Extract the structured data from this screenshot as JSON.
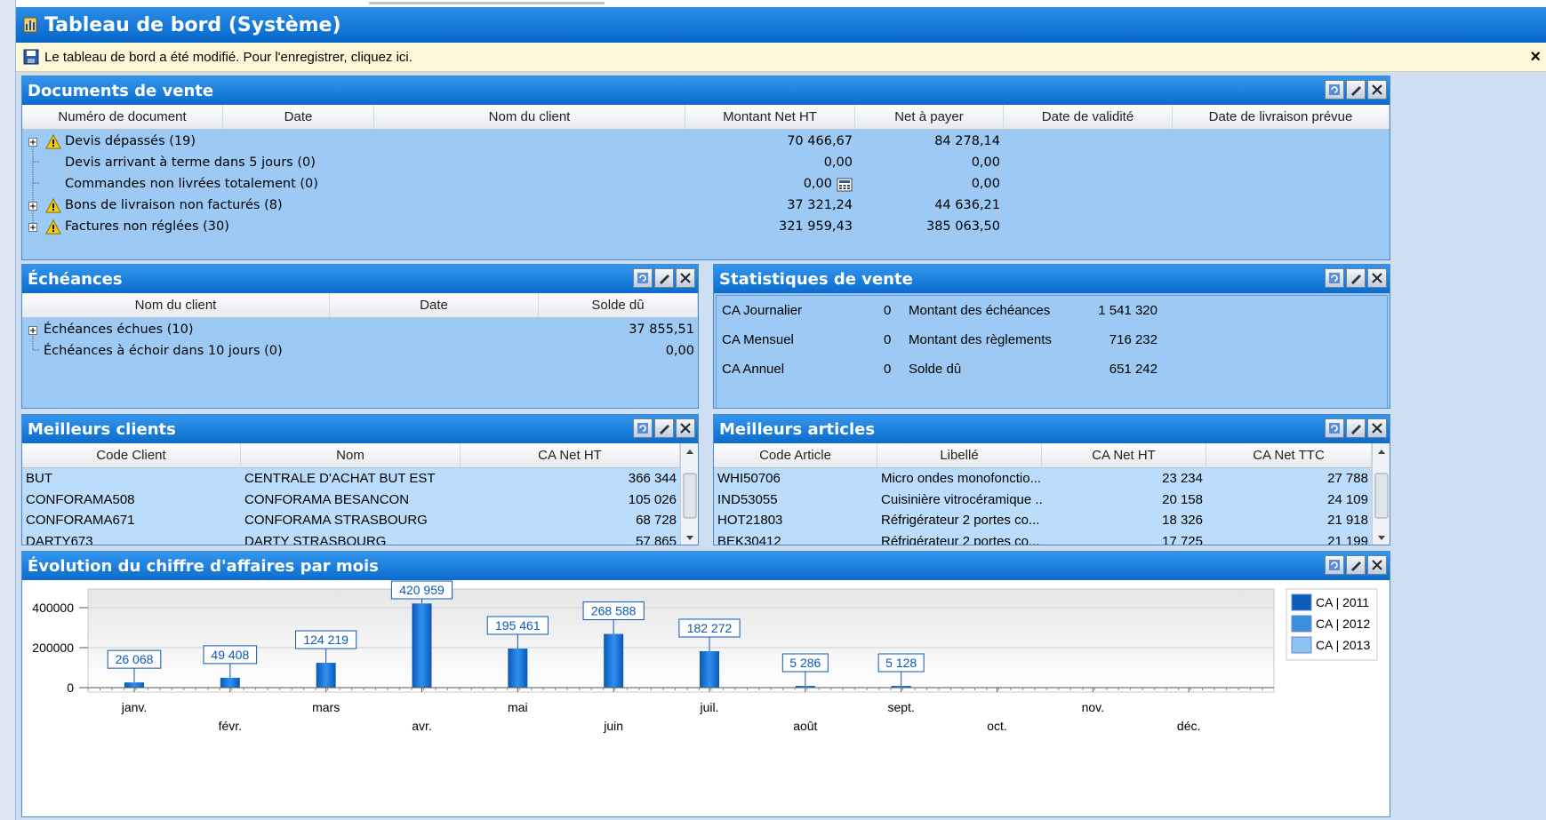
{
  "window": {
    "title": "Tableau de bord (Système)",
    "notice": "Le tableau de bord a été modifié. Pour l'enregistrer, cliquez ici.",
    "close": "×"
  },
  "docs": {
    "title": "Documents de vente",
    "headers": [
      "Numéro de document",
      "Date",
      "Nom du client",
      "Montant Net HT",
      "Net à payer",
      "Date de validité",
      "Date de livraison prévue"
    ],
    "rows": [
      {
        "label": "Devis dépassés (19)",
        "montant": "70 466,67",
        "net": "84 278,14"
      },
      {
        "label": "Devis arrivant à terme dans 5 jours (0)",
        "montant": "0,00",
        "net": "0,00"
      },
      {
        "label": "Commandes non livrées totalement (0)",
        "montant": "0,00",
        "net": "0,00"
      },
      {
        "label": "Bons de livraison non facturés (8)",
        "montant": "37 321,24",
        "net": "44 636,21"
      },
      {
        "label": "Factures non réglées (30)",
        "montant": "321 959,43",
        "net": "385 063,50"
      }
    ]
  },
  "echeances": {
    "title": "Échéances",
    "headers": [
      "Nom du client",
      "Date",
      "Solde dû"
    ],
    "rows": [
      {
        "label": "Échéances échues (10)",
        "solde": "37 855,51"
      },
      {
        "label": "Échéances à échoir dans 10 jours (0)",
        "solde": "0,00"
      }
    ]
  },
  "stats": {
    "title": "Statistiques de vente",
    "rows": [
      {
        "l1": "CA Journalier",
        "v1": "0",
        "l2": "Montant des échéances",
        "v2": "1 541 320"
      },
      {
        "l1": "CA Mensuel",
        "v1": "0",
        "l2": "Montant des règlements",
        "v2": "716 232"
      },
      {
        "l1": "CA Annuel",
        "v1": "0",
        "l2": "Solde dû",
        "v2": "651 242"
      }
    ]
  },
  "clients": {
    "title": "Meilleurs clients",
    "headers": [
      "Code Client",
      "Nom",
      "CA Net HT"
    ],
    "rows": [
      [
        "BUT",
        "CENTRALE D'ACHAT BUT EST",
        "366 344"
      ],
      [
        "CONFORAMA508",
        "CONFORAMA BESANCON",
        "105 026"
      ],
      [
        "CONFORAMA671",
        "CONFORAMA STRASBOURG",
        "68 728"
      ],
      [
        "DARTY673",
        "DARTY STRASBOURG",
        "57 865"
      ]
    ]
  },
  "articles": {
    "title": "Meilleurs articles",
    "headers": [
      "Code Article",
      "Libellé",
      "CA Net HT",
      "CA Net TTC"
    ],
    "rows": [
      [
        "WHI50706",
        "Micro ondes monofonctio...",
        "23 234",
        "27 788"
      ],
      [
        "IND53055",
        "Cuisinière vitrocéramique ...",
        "20 158",
        "24 109"
      ],
      [
        "HOT21803",
        "Réfrigérateur 2 portes co...",
        "18 326",
        "21 918"
      ],
      [
        "BEK30412",
        "Réfrigérateur 2 portes co...",
        "17 725",
        "21 199"
      ]
    ]
  },
  "evolution": {
    "title": "Évolution du chiffre d'affaires par mois"
  },
  "colors": {
    "accent": "#0b6ccd",
    "panel": "#9ccaf5",
    "bar2011": "#0f6fd0"
  },
  "chart_data": {
    "type": "bar",
    "categories": [
      "janv.",
      "févr.",
      "mars",
      "avr.",
      "mai",
      "juin",
      "juil.",
      "août",
      "sept.",
      "oct.",
      "nov.",
      "déc."
    ],
    "series": [
      {
        "name": "CA | 2011",
        "values": [
          26068,
          49408,
          124219,
          420959,
          195461,
          268588,
          182272,
          5286,
          5128,
          0,
          0,
          0
        ]
      },
      {
        "name": "CA | 2012",
        "values": []
      },
      {
        "name": "CA | 2013",
        "values": []
      }
    ],
    "data_labels": [
      "26 068",
      "49 408",
      "124 219",
      "420 959",
      "195 461",
      "268 588",
      "182 272",
      "5 286",
      "5 128"
    ],
    "yticks": [
      "400000",
      "200000",
      "0"
    ],
    "ylim": [
      0,
      420959
    ],
    "grid": true,
    "legend": "right"
  }
}
